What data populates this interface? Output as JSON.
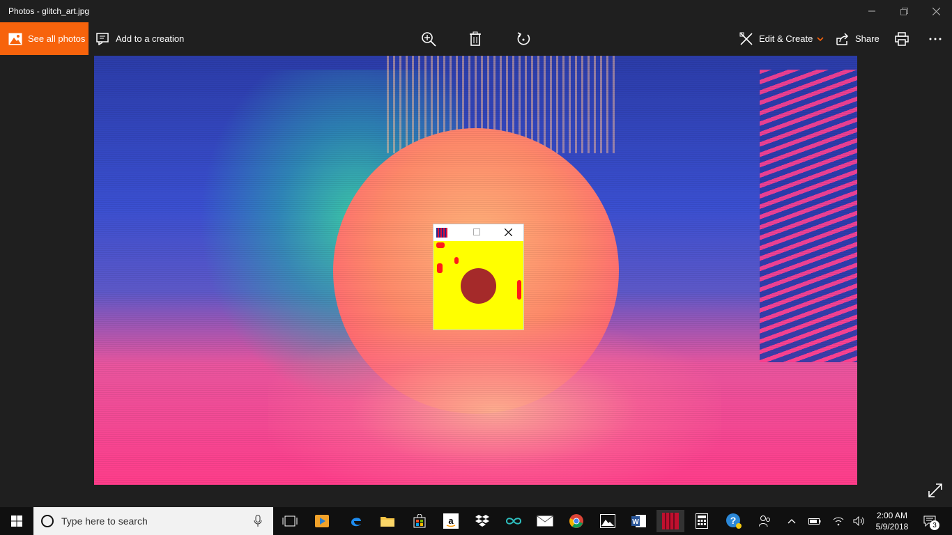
{
  "window": {
    "title": "Photos - glitch_art.jpg"
  },
  "toolbar": {
    "see_all_label": "See all photos",
    "add_to_creation_label": "Add to a creation",
    "edit_create_label": "Edit & Create",
    "share_label": "Share"
  },
  "taskbar": {
    "search_placeholder": "Type here to search",
    "time": "2:00 AM",
    "date": "5/9/2018",
    "notification_count": "3"
  },
  "colors": {
    "accent": "#f7630c",
    "background": "#1f1f1f",
    "mini_window_bg": "#ffff00",
    "mini_window_circle": "#a52a2a"
  }
}
